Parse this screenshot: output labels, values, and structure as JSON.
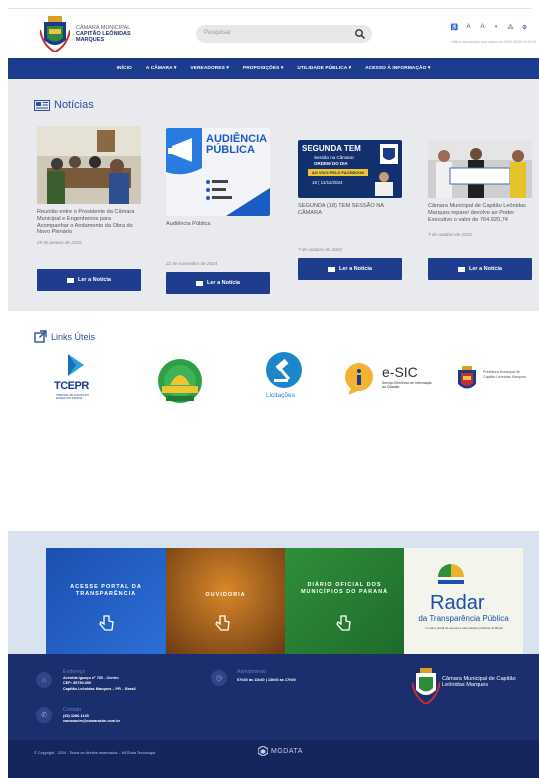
{
  "header": {
    "logo_lines": [
      "CÂMARA MUNICIPAL",
      "CAPITÃO LEÔNIDAS",
      "MARQUES"
    ],
    "search_placeholder": "Pesquisar",
    "last_update": "Última atualização dos dados em 20/01/2025 14:44:25"
  },
  "nav": {
    "items": [
      "INÍCIO",
      "A CÂMARA ▾",
      "VEREADORES ▾",
      "PROPOSIÇÕES ▾",
      "UTILIDADE PÚBLICA ▾",
      "ACESSO À INFORMAÇÃO ▾"
    ]
  },
  "news": {
    "title": "Notícias",
    "read_more": "Ler a Notícia",
    "cards": [
      {
        "title": "Reunião entre o Presidente da Câmara Municipal e Engenheiros para Acompanhar o Andamento da Obra do Novo Plenário",
        "date": "29 de janeiro de 2025"
      },
      {
        "title": "Audiência Pública",
        "date": "22 de novembro de 2024",
        "thumb_title": "AUDIÊNCIA PÚBLICA"
      },
      {
        "title": "SEGUNDA (18) TEM SESSÃO NA CÂMARA",
        "date": "7 de outubro de 2024",
        "thumb_title": "SEGUNDA TEM",
        "thumb_sub": "Sessão na Câmara!",
        "thumb_sub2": "ORDEM DO DIA",
        "thumb_band": "AO VIVO PELO FACEBOOK",
        "thumb_date": "18 | 11/11/2024"
      },
      {
        "title": "Câmara Municipal de Capitão Leônidas Marques repare/ devolve ao Poder Executivo o valor de 764.920,74",
        "date": "7 de outubro de 2024"
      }
    ]
  },
  "links": {
    "title": "Links Úteis",
    "tcepr": "TCEPR",
    "tcepr_sub": "TRIBUNAL DE CONTAS DO ESTADO DO PARANÁ",
    "licitacoes": "Licitações",
    "esic": "e-SIC",
    "esic_sub": "Serviço Eletrônico de Informação ao Cidadão",
    "prefeitura": "Prefeitura Municipal de Capitão Leônidas Marques"
  },
  "banners": {
    "b1": "ACESSE PORTAL DA TRANSPARÊNCIA",
    "b2": "OUVIDORIA",
    "b3": "DIÁRIO OFICIAL DOS MUNICÍPIOS DO PARANÁ",
    "b4_title": "Radar",
    "b4_sub": "da Transparência Pública",
    "b4_small": "O maior portal de acesso a informações públicas do Brasil"
  },
  "footer": {
    "address_label": "Endereço",
    "address_lines": [
      "Avenida Iguaçu nº 760 - Centro",
      "CEP: 85790-000",
      "Capitão Leônidas Marques – PR – Brasil"
    ],
    "hours_label": "Atendimento",
    "hours_value": "07h30 às 11h30 | 13h00 às 17h00",
    "contact_label": "Contato",
    "contact_lines": [
      "(45) 3286-1145",
      "camaracim@camaraclm.com.br"
    ],
    "footer_logo": "Câmara Municipal de Capitão Leônidas Marques",
    "copyright": "© Copyright - 2024 - Todos os direitos reservados – MGData Tecnologia",
    "brand": "MGDATA"
  },
  "colors": {
    "primary": "#1d3c8f",
    "footer": "#1b2f6e",
    "news_bg": "#e9eaee"
  }
}
